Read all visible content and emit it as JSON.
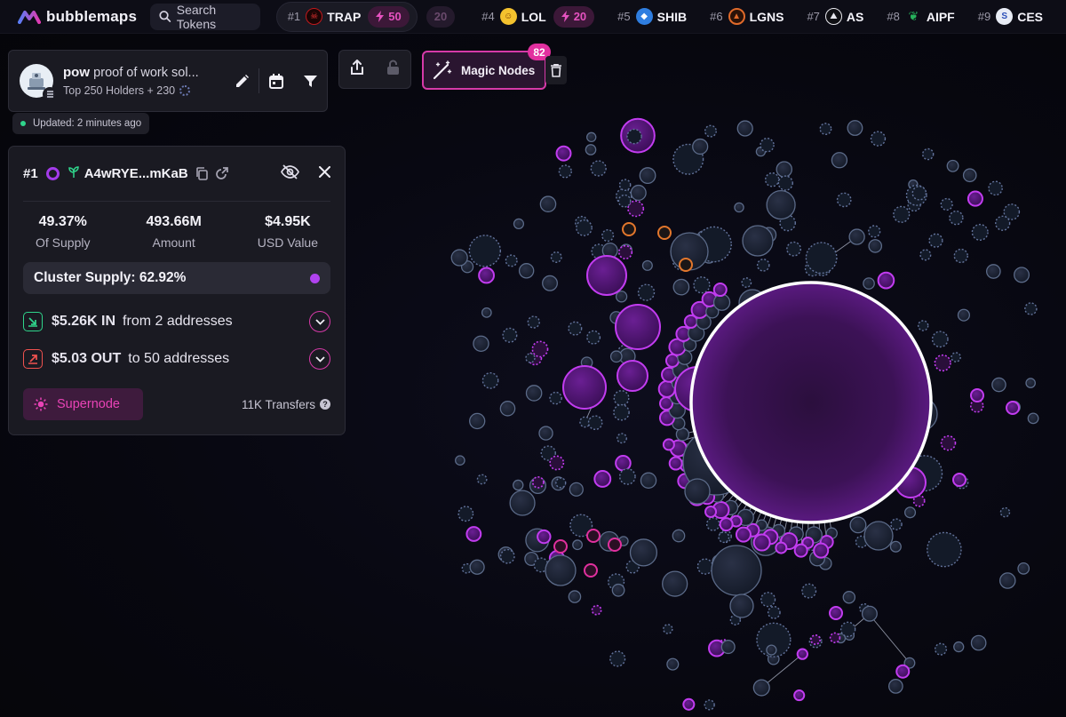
{
  "app": {
    "name": "bubblemaps"
  },
  "search": {
    "label": "Search Tokens"
  },
  "trending": [
    {
      "rank": "#1",
      "name": "TRAP",
      "boost": "50",
      "ghost_boost": "20",
      "color": "#c2181c"
    },
    {
      "rank": "#4",
      "name": "LOL",
      "boost": "20",
      "color": "#f4c22e"
    },
    {
      "rank": "#5",
      "name": "SHIB",
      "color": "#2f7ee0"
    },
    {
      "rank": "#6",
      "name": "LGNS",
      "color": "#e06a2a"
    },
    {
      "rank": "#7",
      "name": "AS",
      "color": "#e8e8ee"
    },
    {
      "rank": "#8",
      "name": "AIPF",
      "color": "#27b35c"
    },
    {
      "rank": "#9",
      "name": "CES",
      "color": "#2b4fb8"
    }
  ],
  "token": {
    "symbol": "pow",
    "name": "proof of work sol...",
    "subtitle": "Top 250 Holders + 230"
  },
  "updated": "Updated: 2 minutes ago",
  "magic": {
    "label": "Magic Nodes",
    "count": "82"
  },
  "panel": {
    "rank": "#1",
    "address": "A4wRYE...mKaB",
    "stats": [
      {
        "value": "49.37%",
        "label": "Of Supply"
      },
      {
        "value": "493.66M",
        "label": "Amount"
      },
      {
        "value": "$4.95K",
        "label": "USD Value"
      }
    ],
    "cluster": "Cluster Supply: 62.92%",
    "inflow": {
      "value": "$5.26K IN",
      "detail": "from 2 addresses"
    },
    "outflow": {
      "value": "$5.03 OUT",
      "detail": "to 50 addresses"
    },
    "supernode": "Supernode",
    "transfers": "11K Transfers"
  },
  "colors": {
    "accent": "#d63aa8",
    "purple": "#a33bea",
    "node_dark": "#1c2233",
    "node_edge": "#5b6a88",
    "inflow": "#2fd48b",
    "outflow": "#f0524f"
  },
  "icons": [
    "search-icon",
    "bolt-icon",
    "pencil-icon",
    "calendar-icon",
    "filter-icon",
    "share-icon",
    "lock-icon",
    "magic-wand-icon",
    "trash-icon",
    "copy-icon",
    "external-link-icon",
    "eye-off-icon",
    "close-icon",
    "sprout-icon",
    "chevron-down-icon",
    "sun-icon",
    "help-icon"
  ]
}
